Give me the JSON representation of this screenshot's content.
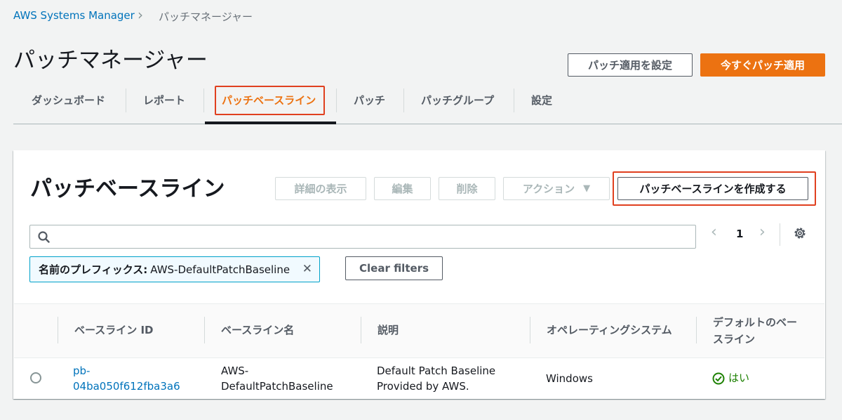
{
  "breadcrumb": {
    "root": "AWS Systems Manager",
    "separator": "›",
    "current": "パッチマネージャー"
  },
  "header": {
    "title": "パッチマネージャー",
    "configure_button": "パッチ適用を設定",
    "patch_now_button": "今すぐパッチ適用"
  },
  "tabs": [
    {
      "label": "ダッシュボード"
    },
    {
      "label": "レポート"
    },
    {
      "label": "パッチベースライン",
      "active": true
    },
    {
      "label": "パッチ"
    },
    {
      "label": "パッチグループ"
    },
    {
      "label": "設定"
    }
  ],
  "panel": {
    "title": "パッチベースライン",
    "buttons": {
      "view_details": "詳細の表示",
      "edit": "編集",
      "delete": "削除",
      "actions": "アクション",
      "actions_caret": "▼",
      "create": "パッチベースラインを作成する"
    },
    "search": {
      "placeholder": "",
      "value": ""
    },
    "pagination": {
      "page": "1",
      "prev": "‹",
      "next": "›"
    },
    "filter_token": {
      "key": "名前のプレフィックス:",
      "value": "AWS-DefaultPatchBaseline",
      "remove": "✕"
    },
    "clear_filters": "Clear filters"
  },
  "table": {
    "columns": [
      "ベースライン ID",
      "ベースライン名",
      "説明",
      "オペレーティングシステム",
      "デフォルトのベー",
      "スライン"
    ],
    "rows": [
      {
        "id_line1": "pb-",
        "id_line2": "04ba050f612fba3a6",
        "name_line1": "AWS-",
        "name_line2": "DefaultPatchBaseline",
        "desc_line1": "Default Patch Baseline",
        "desc_line2": "Provided by AWS.",
        "os": "Windows",
        "default": "はい"
      }
    ]
  },
  "colors": {
    "accent_orange": "#ec7211",
    "link_blue": "#0073bb",
    "highlight_red": "#e0401f",
    "success_green": "#1d8102"
  }
}
